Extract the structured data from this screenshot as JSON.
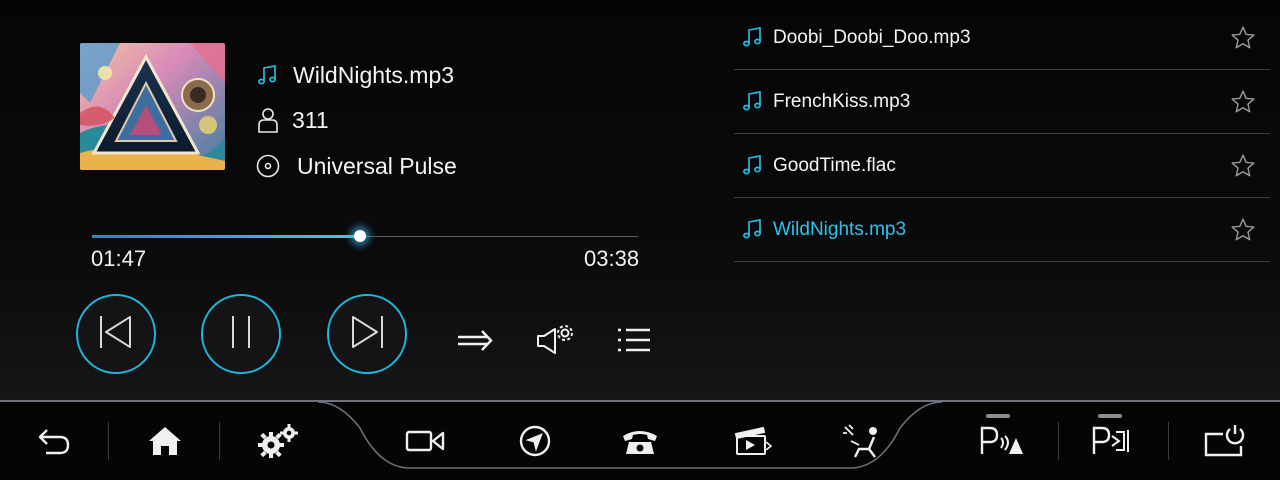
{
  "now_playing": {
    "title": "WildNights.mp3",
    "artist": "311",
    "album": "Universal Pulse",
    "icons": {
      "title": "music-note-icon",
      "artist": "person-icon",
      "album": "disc-icon"
    }
  },
  "progress": {
    "elapsed": "01:47",
    "total": "03:38",
    "fraction": 0.491
  },
  "controls": {
    "previous": "skip-previous-icon",
    "pause": "pause-icon",
    "next": "skip-next-icon",
    "play_mode": "sequential-play-icon",
    "sound_settings": "speaker-settings-icon",
    "playlist": "list-icon"
  },
  "playlist": {
    "items": [
      {
        "name": "Doobi_Doobi_Doo.mp3",
        "active": false
      },
      {
        "name": "FrenchKiss.mp3",
        "active": false
      },
      {
        "name": "GoodTime.flac",
        "active": false
      },
      {
        "name": "WildNights.mp3",
        "active": true
      }
    ]
  },
  "bottom_bar": {
    "left": [
      "back-icon",
      "home-icon",
      "settings-icon"
    ],
    "center": [
      "camera-icon",
      "navigation-icon",
      "phone-icon",
      "media-icon",
      "seat-climate-icon"
    ],
    "right": [
      "park-assist-icon",
      "auto-park-icon",
      "power-display-icon"
    ]
  },
  "colors": {
    "accent": "#2cc3ea",
    "button_ring": "#1fb6d8",
    "background": "#0b0b0c",
    "bar_background": "#050506"
  }
}
